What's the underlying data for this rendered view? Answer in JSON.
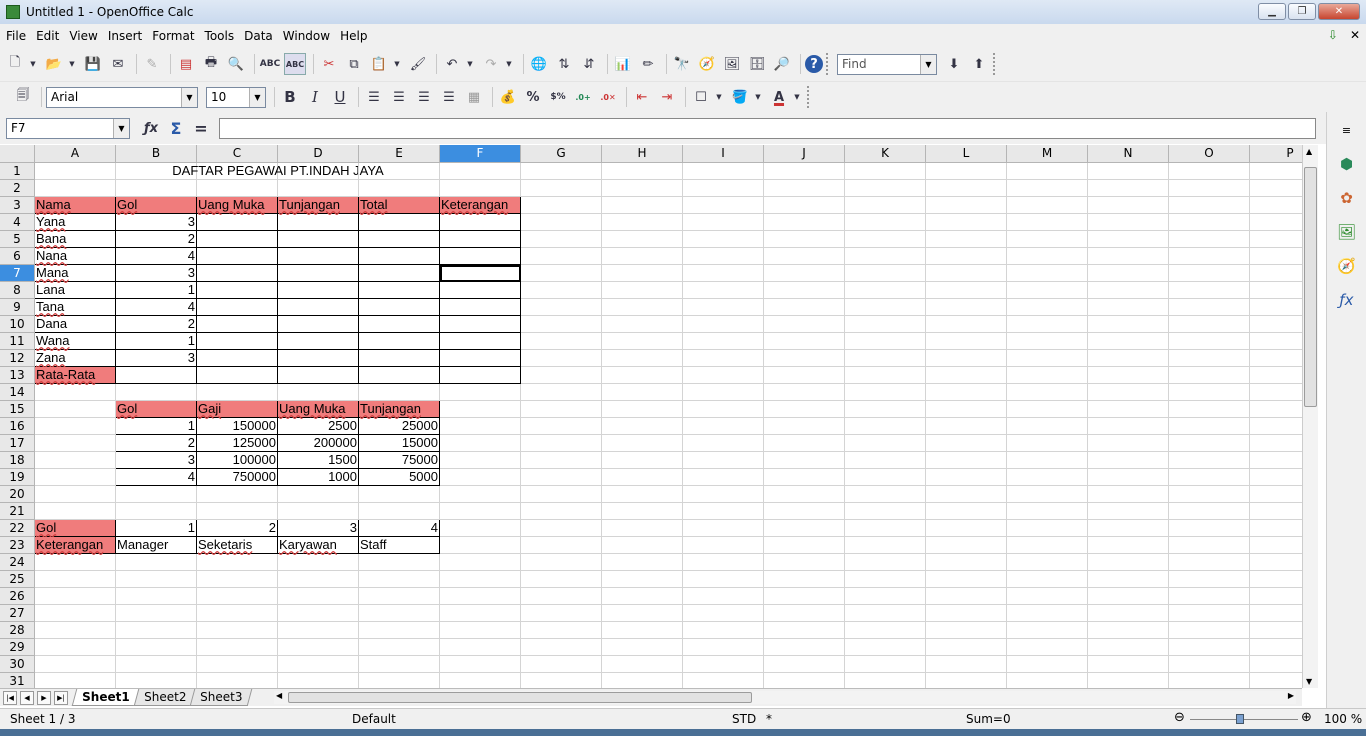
{
  "window": {
    "title": "Untitled 1 - OpenOffice Calc",
    "minimize": "▁",
    "restore": "❐",
    "close": "✕"
  },
  "menu": [
    "File",
    "Edit",
    "View",
    "Insert",
    "Format",
    "Tools",
    "Data",
    "Window",
    "Help"
  ],
  "toolbar": {
    "find_placeholder": "Find",
    "font_name": "Arial",
    "font_size": "10"
  },
  "formula_bar": {
    "name_box": "F7",
    "fx": "ƒx",
    "sum": "Σ",
    "equals": "=",
    "content": ""
  },
  "columns": [
    "A",
    "B",
    "C",
    "D",
    "E",
    "F",
    "G",
    "H",
    "I",
    "J",
    "K",
    "L",
    "M",
    "N",
    "O",
    "P"
  ],
  "selected_cell": "F7",
  "cells": {
    "title": "DAFTAR PEGAWAI PT.INDAH JAYA",
    "row3": [
      "Nama",
      "Gol",
      "Uang Muka",
      "Tunjangan",
      "Total",
      "Keterangan"
    ],
    "employees": [
      [
        "Yana",
        "3"
      ],
      [
        "Bana",
        "2"
      ],
      [
        "Nana",
        "4"
      ],
      [
        "Mana",
        "3"
      ],
      [
        "Lana",
        "1"
      ],
      [
        "Tana",
        "4"
      ],
      [
        "Dana",
        "2"
      ],
      [
        "Wana",
        "1"
      ],
      [
        "Zana",
        "3"
      ]
    ],
    "rata": "Rata-Rata",
    "row15": [
      "Gol",
      "Gaji",
      "Uang Muka",
      "Tunjangan"
    ],
    "salary": [
      [
        "1",
        "150000",
        "2500",
        "25000"
      ],
      [
        "2",
        "125000",
        "200000",
        "15000"
      ],
      [
        "3",
        "100000",
        "1500",
        "75000"
      ],
      [
        "4",
        "750000",
        "1000",
        "5000"
      ]
    ],
    "row22": [
      "Gol",
      "1",
      "2",
      "3",
      "4"
    ],
    "row23": [
      "Keterangan",
      "Manager",
      "Seketaris",
      "Karyawan",
      "Staff"
    ]
  },
  "sheets": [
    "Sheet1",
    "Sheet2",
    "Sheet3"
  ],
  "status": {
    "sheet": "Sheet 1 / 3",
    "style": "Default",
    "mode": "STD",
    "modified": "*",
    "sum": "Sum=0",
    "zoom": "100 %"
  }
}
